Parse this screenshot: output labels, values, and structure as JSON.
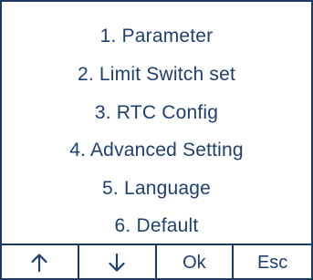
{
  "menu": {
    "items": [
      {
        "label": "1. Parameter"
      },
      {
        "label": "2. Limit Switch set"
      },
      {
        "label": "3. RTC Config"
      },
      {
        "label": "4. Advanced Setting"
      },
      {
        "label": "5. Language"
      },
      {
        "label": "6. Default"
      }
    ]
  },
  "softkeys": {
    "up": {
      "icon": "arrow-up-icon"
    },
    "down": {
      "icon": "arrow-down-icon"
    },
    "ok": {
      "label": "Ok"
    },
    "esc": {
      "label": "Esc"
    }
  },
  "colors": {
    "text": "#1d3f73",
    "border": "#1b3a6b",
    "background": "#ffffff"
  }
}
